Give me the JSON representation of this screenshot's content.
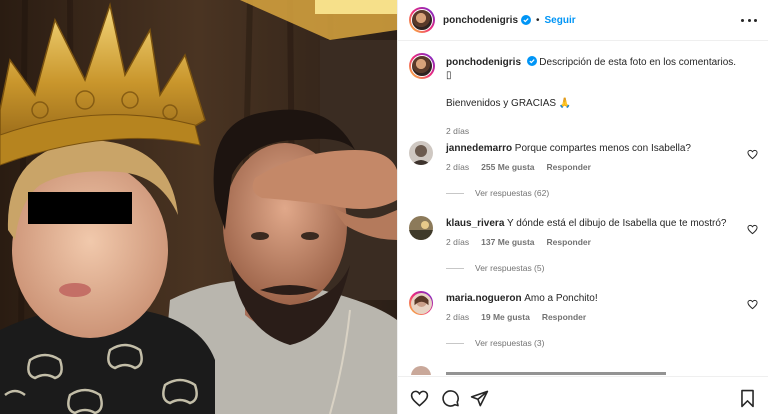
{
  "header": {
    "username": "ponchodenigris",
    "separator": "•",
    "follow_label": "Seguir"
  },
  "caption": {
    "username": "ponchodenigris",
    "text": "Descripción de esta foto en los comentarios. 🇦",
    "text_main": "Descripción de esta foto en los comentarios.",
    "glyph": "▯",
    "line2": "Bienvenidos y GRACIAS 🙏",
    "time": "2 días"
  },
  "comments": [
    {
      "username": "jannedemarro",
      "text": "Porque compartes menos con Isabella?",
      "time": "2 días",
      "likes": "255 Me gusta",
      "reply": "Responder",
      "view_replies": "Ver respuestas (62)"
    },
    {
      "username": "klaus_rivera",
      "text": "Y dónde está el dibujo de Isabella que te mostró?",
      "time": "2 días",
      "likes": "137 Me gusta",
      "reply": "Responder",
      "view_replies": "Ver respuestas (5)"
    },
    {
      "username": "maria.nogueron",
      "text": "Amo a Ponchito!",
      "time": "2 días",
      "likes": "19 Me gusta",
      "reply": "Responder",
      "view_replies": "Ver respuestas (3)"
    }
  ],
  "icons": {
    "verified": "verified-badge-icon",
    "more": "more-options-icon",
    "like": "heart-icon",
    "comment": "comment-icon",
    "share": "share-icon",
    "save": "bookmark-icon"
  },
  "colors": {
    "link_blue": "#0095f6",
    "text": "#262626",
    "muted": "#737373",
    "border": "#efefef"
  }
}
